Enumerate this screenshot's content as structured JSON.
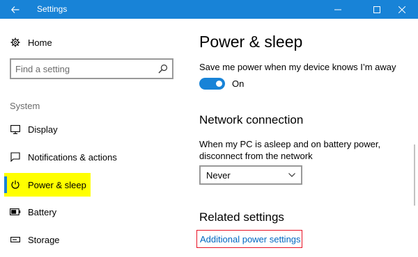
{
  "window": {
    "title": "Settings",
    "accent_color": "#1883d7"
  },
  "sidebar": {
    "home_label": "Home",
    "search_placeholder": "Find a setting",
    "section_label": "System",
    "items": [
      {
        "label": "Display",
        "icon": "monitor-icon"
      },
      {
        "label": "Notifications & actions",
        "icon": "notifications-icon"
      },
      {
        "label": "Power & sleep",
        "icon": "power-icon",
        "selected": true,
        "highlight_color": "#ffff00"
      },
      {
        "label": "Battery",
        "icon": "battery-icon"
      },
      {
        "label": "Storage",
        "icon": "storage-icon"
      }
    ]
  },
  "main": {
    "title": "Power & sleep",
    "power_saving": {
      "description": "Save me power when my device knows I’m away",
      "toggle_state": "On"
    },
    "network": {
      "heading": "Network connection",
      "description": "When my PC is asleep and on battery power, disconnect from the network",
      "selected_option": "Never"
    },
    "related": {
      "heading": "Related settings",
      "link_label": "Additional power settings",
      "link_outline_color": "#e81123"
    }
  }
}
